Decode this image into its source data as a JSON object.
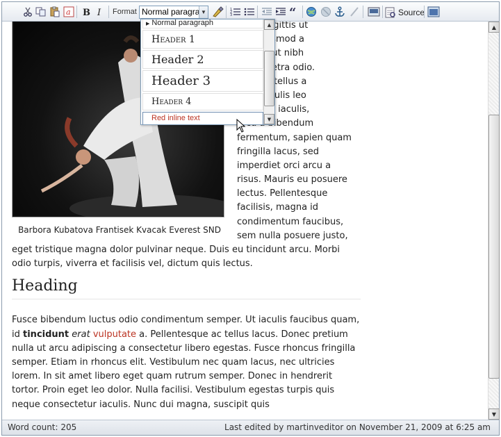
{
  "toolbar": {
    "format_label": "Format",
    "format_selected": "Normal paragraph",
    "source_label": "Source",
    "icons": [
      "cut-icon",
      "copy-icon",
      "paste-icon",
      "paste-word-icon",
      "bold-icon",
      "italic-icon",
      "clean-format-icon",
      "numbered-list-icon",
      "bullet-list-icon",
      "outdent-icon",
      "indent-icon",
      "blockquote-icon",
      "link-icon",
      "unlink-icon",
      "anchor-icon",
      "special-char-icon",
      "image-icon",
      "source-icon",
      "fullscreen-icon"
    ]
  },
  "format_dropdown": {
    "items": [
      {
        "label": "Normal paragraph",
        "style": "normal"
      },
      {
        "label": "Header 1",
        "style": "h1"
      },
      {
        "label": "Header 2",
        "style": "h2"
      },
      {
        "label": "Header 3",
        "style": "h3"
      },
      {
        "label": "Header 4",
        "style": "h4"
      },
      {
        "label": "Red inline text",
        "style": "red"
      }
    ]
  },
  "content": {
    "caption": "Barbora Kubatova Frantisek Kvacak Everest SND",
    "para1_lines": [
      "ante, sagittis ut",
      "tae, euismod a",
      "ecenas ut nibh",
      "on pharetra odio.",
      "fringilla tellus a",
      "us id iaculis leo",
      ". Integer iaculis,",
      "arcu a bibendum",
      "fermentum, sapien quam",
      "fringilla lacus, sed",
      "imperdiet orci arcu a",
      "risus. Mauris eu posuere",
      "lectus. Pellentesque",
      "facilisis, magna id",
      "condimentum faucibus,",
      "sem nulla posuere justo,"
    ],
    "para1_tail": "eget tristique magna dolor pulvinar neque. Duis eu tincidunt arcu. Morbi odio turpis, viverra et facilisis vel, dictum quis lectus.",
    "heading": "Heading",
    "para2_start": "Fusce bibendum luctus odio condimentum semper. Ut iaculis faucibus quam, id",
    "para2_bold": "tincidunt",
    "para2_italic": "erat",
    "para2_red": "vulputate",
    "para2_rest": "a. Pellentesque ac tellus lacus. Donec pretium nulla ut arcu adipiscing a consectetur libero egestas. Fusce rhoncus fringilla semper. Etiam in rhoncus elit. Vestibulum nec quam lacus, nec ultricies lorem. In sit amet libero eget quam rutrum semper. Donec in hendrerit tortor. Proin eget leo dolor. Nulla facilisi. Vestibulum egestas turpis quis neque consectetur iaculis. Nunc dui magna, suscipit quis"
  },
  "status": {
    "word_count": "Word count: 205",
    "last_edited": "Last edited by martinveditor on November 21, 2009 at 6:25 am"
  }
}
